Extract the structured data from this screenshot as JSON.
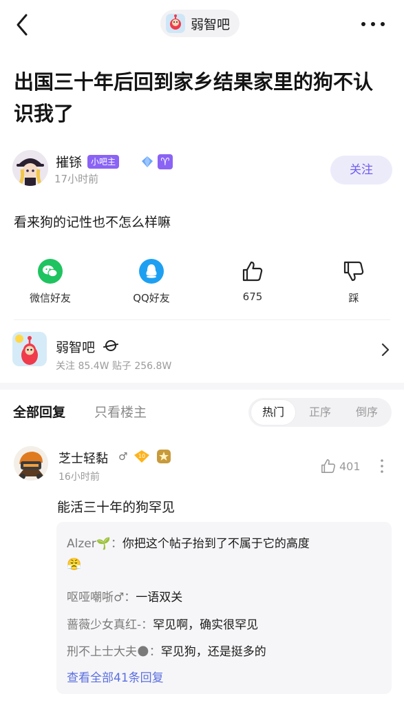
{
  "header": {
    "forum_pill_label": "弱智吧"
  },
  "post": {
    "title": "出国三十年后回到家乡结果家里的狗不认识我了",
    "body": "看来狗的记性也不怎么样嘛"
  },
  "author": {
    "name": "摧铩",
    "badge": "小吧主",
    "zodiac": "♈",
    "time": "17小时前",
    "follow_label": "关注"
  },
  "share": {
    "wechat": "微信好友",
    "qq": "QQ好友",
    "like_count": "675",
    "dislike": "踩"
  },
  "forum": {
    "name": "弱智吧",
    "stats": "关注 85.4W  贴子 256.8W"
  },
  "reply_tabs": {
    "all": "全部回复",
    "only_op": "只看楼主",
    "sort": [
      "热门",
      "正序",
      "倒序"
    ],
    "active_sort": "热门"
  },
  "comment": {
    "name": "芝士轻黏",
    "gender": "♂",
    "level": "10",
    "time": "16小时前",
    "likes": "401",
    "text": "能活三十年的狗罕见",
    "sub_replies": [
      {
        "user": "Alzer🌱：",
        "text": "你把这个帖子抬到了不属于它的高度",
        "extra": "😤"
      },
      {
        "user": "呕哑嘲哳♂：",
        "text": "一语双关"
      },
      {
        "user": "蔷薇少女真红-：",
        "text": "罕见啊，确实很罕见"
      },
      {
        "user": "刑不上士大夫🌑：",
        "text": "罕见狗，还是挺多的"
      }
    ],
    "view_all": "查看全部41条回复"
  },
  "colors": {
    "accent": "#6f5cf0",
    "link": "#5b6fe0",
    "wechat": "#1fc35f",
    "qq": "#1ea0f2"
  }
}
